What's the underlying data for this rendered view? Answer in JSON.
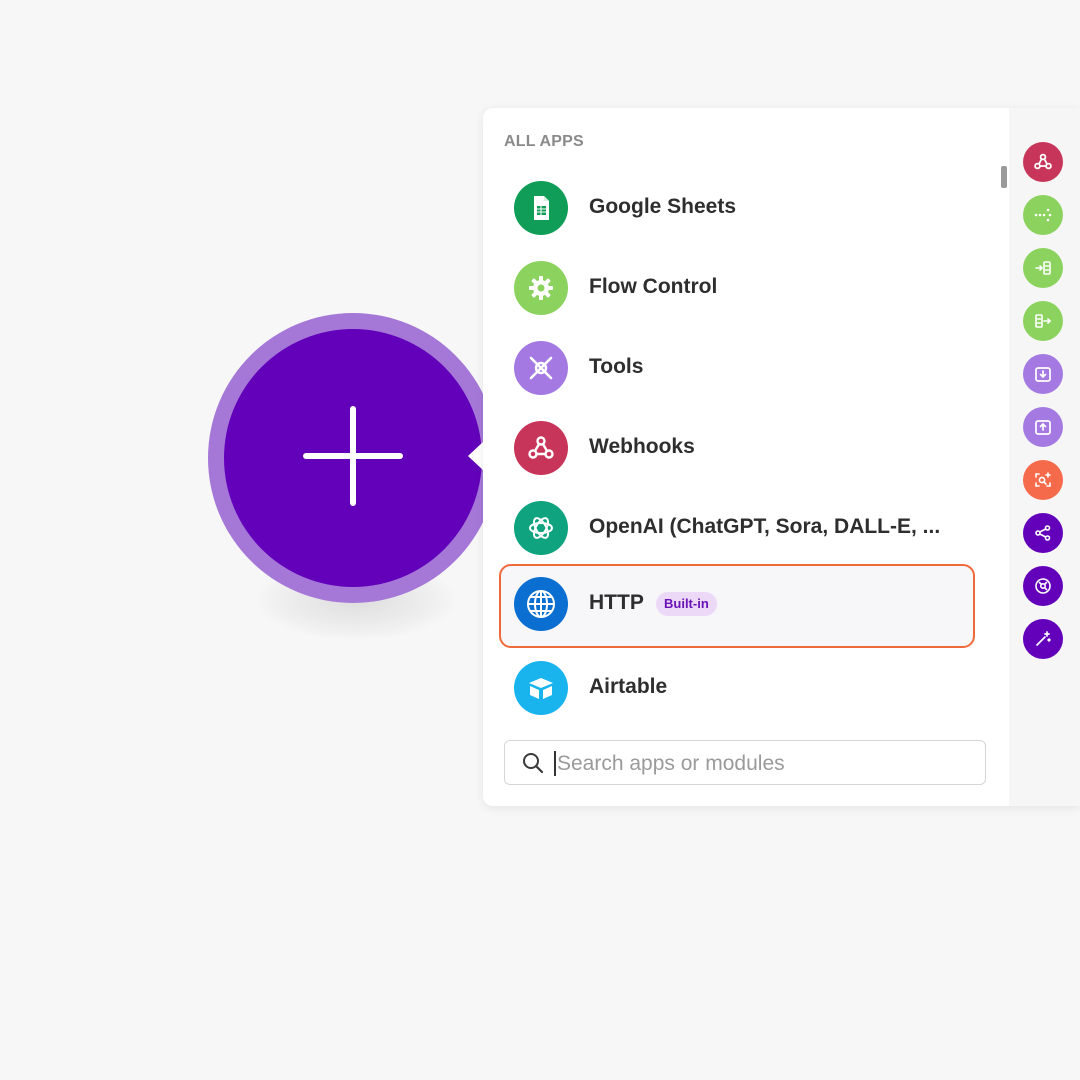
{
  "canvas": {
    "add_button_icon": "plus-icon"
  },
  "panel": {
    "section_label": "ALL APPS",
    "apps": [
      {
        "label": "Google Sheets",
        "icon": "google-sheets-icon",
        "color": "#0f9d58"
      },
      {
        "label": "Flow Control",
        "icon": "gear-icon",
        "color": "#8bd35e"
      },
      {
        "label": "Tools",
        "icon": "tools-icon",
        "color": "#a47ae2"
      },
      {
        "label": "Webhooks",
        "icon": "webhook-icon",
        "color": "#c8355a"
      },
      {
        "label": "OpenAI (ChatGPT, Sora, DALL-E, ...",
        "icon": "openai-icon",
        "color": "#10a37f"
      },
      {
        "label": "HTTP",
        "badge": "Built-in",
        "icon": "globe-icon",
        "color": "#0b6fd1"
      },
      {
        "label": "Airtable",
        "icon": "airtable-icon",
        "color": "#19b4ee"
      }
    ],
    "search": {
      "placeholder": "Search apps or modules",
      "value": ""
    }
  },
  "rail": {
    "buttons": [
      {
        "icon": "webhook-icon",
        "color": "#c8355a"
      },
      {
        "icon": "router-icon",
        "color": "#8bd35e"
      },
      {
        "icon": "iterator-icon",
        "color": "#8bd35e"
      },
      {
        "icon": "aggregator-icon",
        "color": "#8bd35e"
      },
      {
        "icon": "download-icon",
        "color": "#a47ae2"
      },
      {
        "icon": "upload-icon",
        "color": "#a47ae2"
      },
      {
        "icon": "scan-icon",
        "color": "#f46a4a"
      },
      {
        "icon": "share-icon",
        "color": "#6300ba"
      },
      {
        "icon": "ai-agent-icon",
        "color": "#6300ba"
      },
      {
        "icon": "magic-wand-icon",
        "color": "#6300ba"
      }
    ]
  }
}
